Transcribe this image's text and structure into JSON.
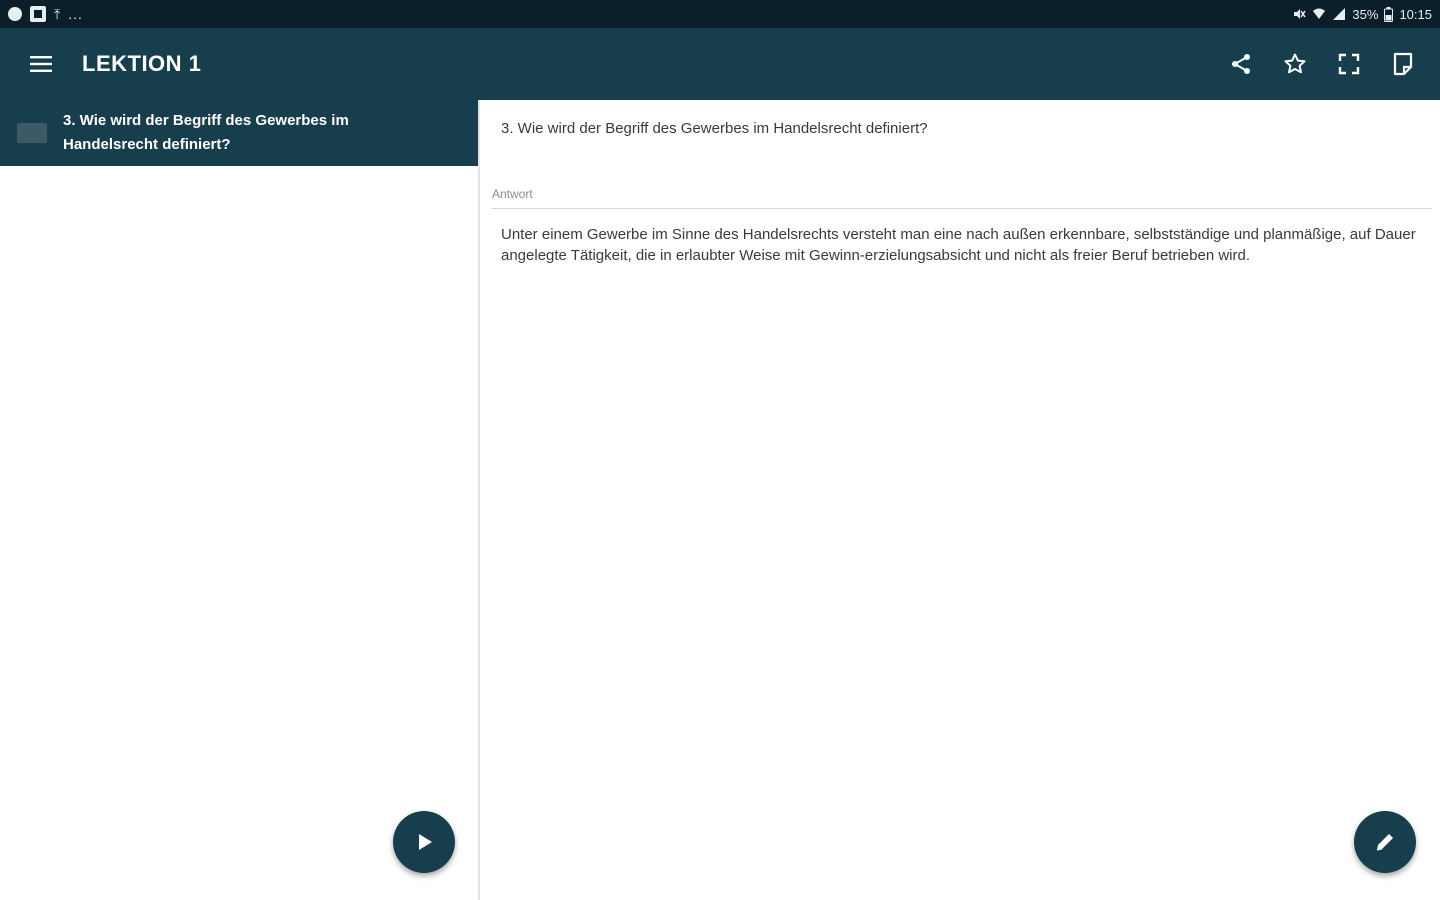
{
  "status_bar": {
    "left_ellipsis": "...",
    "battery_text": "35%",
    "time": "10:15"
  },
  "toolbar": {
    "title": "LEKTION 1",
    "icons": [
      "menu-icon",
      "share-icon",
      "star-icon",
      "fullscreen-icon",
      "tablet-icon"
    ]
  },
  "card_list": {
    "items": [
      {
        "label": "3. Wie wird der Begriff des Gewerbes im Handelsrecht definiert?"
      }
    ]
  },
  "detail": {
    "question": "3. Wie wird der Begriff des Gewerbes im Handelsrecht definiert?",
    "answer_label": "Antwort",
    "answer": "Unter einem Gewerbe im Sinne des Handelsrechts versteht man eine nach außen erkennbare, selbstständige und planmäßige, auf Dauer angelegte Tätigkeit, die in erlaubter Weise mit Gewinn-erzielungsabsicht und nicht als freier Beruf betrieben wird."
  },
  "colors": {
    "primary": "#173e4c",
    "status_bar": "#0b1f2a",
    "text": "#3a3a3a",
    "label": "#8a8a8a"
  }
}
